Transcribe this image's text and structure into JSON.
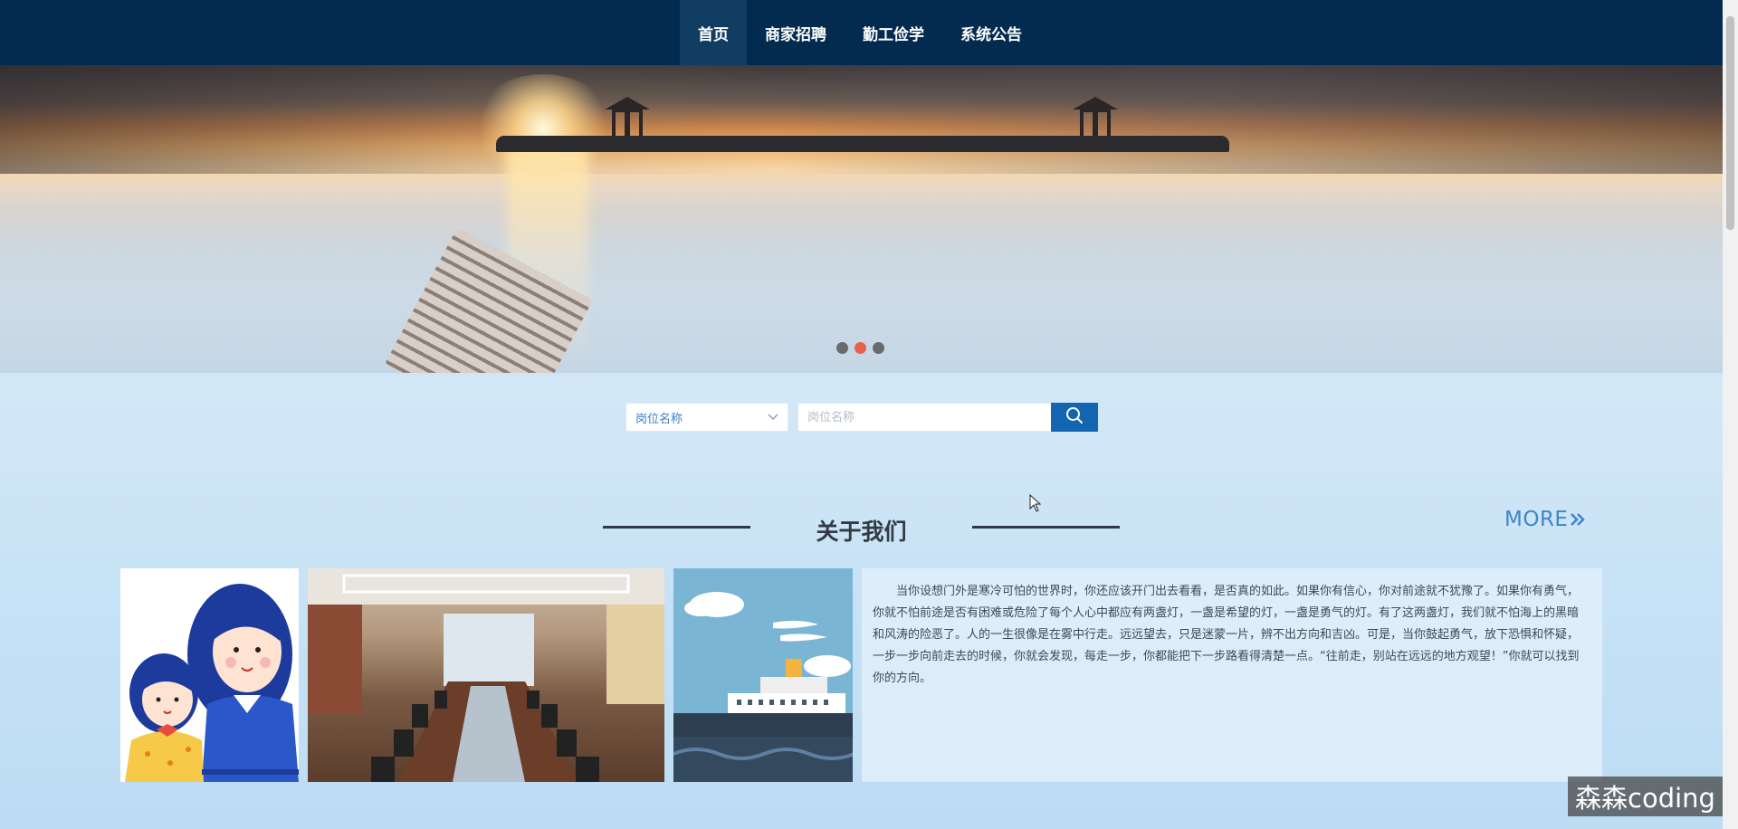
{
  "nav": {
    "items": [
      {
        "label": "首页",
        "active": true
      },
      {
        "label": "商家招聘",
        "active": false
      },
      {
        "label": "勤工俭学",
        "active": false
      },
      {
        "label": "系统公告",
        "active": false
      }
    ]
  },
  "banner": {
    "slide_count": 3,
    "active_slide": 2
  },
  "search": {
    "select_value": "岗位名称",
    "input_placeholder": "岗位名称",
    "button_icon": "search-icon"
  },
  "about": {
    "title": "关于我们",
    "more_label": "MORE",
    "more_icon": "double-chevron-right-icon",
    "text": "当你设想门外是寒冷可怕的世界时，你还应该开门出去看看，是否真的如此。如果你有信心，你对前途就不犹豫了。如果你有勇气，你就不怕前途是否有困难或危险了每个人心中都应有两盏灯，一盏是希望的灯，一盏是勇气的灯。有了这两盏灯，我们就不怕海上的黑暗和风涛的险恶了。人的一生很像是在雾中行走。远远望去，只是迷蒙一片，辨不出方向和吉凶。可是，当你鼓起勇气，放下恐惧和怀疑，一步一步向前走去的时候，你就会发现，每走一步，你都能把下一步路看得清楚一点。“往前走，别站在远远的地方观望！”你就可以找到你的方向。",
    "images": [
      "cartoon-girls-image",
      "conference-room-image",
      "cruise-ship-illustration-image"
    ]
  },
  "watermark": {
    "text": "森森coding"
  },
  "colors": {
    "nav_bg": "#032b4f",
    "nav_active_bg": "#113d63",
    "accent": "#1266b0",
    "more_link": "#3e86cc",
    "active_dot": "#e8604a"
  }
}
